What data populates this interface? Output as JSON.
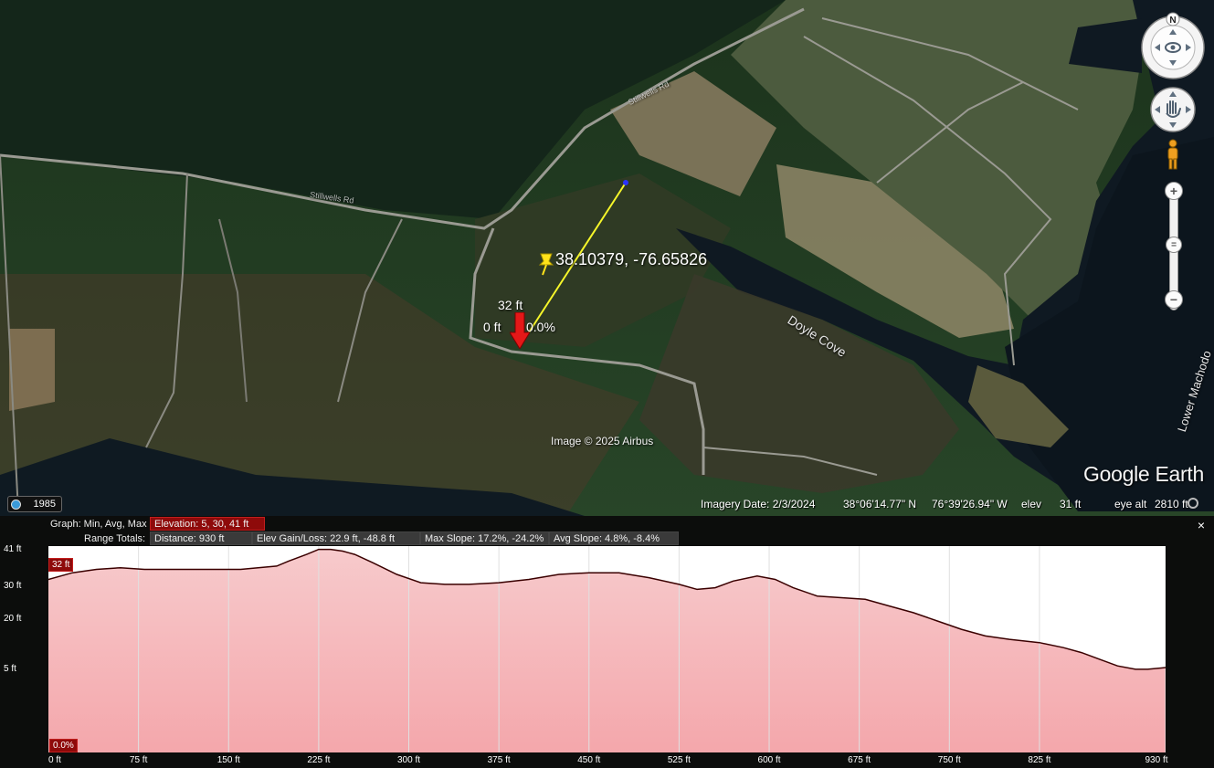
{
  "map": {
    "coordinate_label": "38.10379, -76.65826",
    "elevation_flag": "32 ft",
    "zero_flag": "0 ft",
    "percent_flag": "0.0%",
    "place_labels": {
      "cove": "Doyle Cove",
      "river": "Lower Machodo",
      "road_upper": "Stillwells Rd",
      "road_left": "Stillwells Rd"
    },
    "copyright": "Image © 2025 Airbus",
    "brand": "Google Earth",
    "history_year": "1985",
    "compass_letter": "N"
  },
  "status_bar": {
    "imagery_date": "Imagery Date: 2/3/2024",
    "latitude": "38°06'14.77\" N",
    "longitude": "76°39'26.94\" W",
    "elev_label": "elev",
    "elev_value": "31 ft",
    "eye_alt_label": "eye alt",
    "eye_alt_value": "2810 ft"
  },
  "profile": {
    "close_label": "×",
    "graph_label": "Graph: Min, Avg, Max",
    "elevation_stat": "Elevation: 5, 30, 41 ft",
    "range_label": "Range Totals:",
    "distance_stat": "Distance: 930 ft",
    "gain_stat": "Elev Gain/Loss: 22.9 ft, -48.8 ft",
    "max_slope_stat": "Max Slope: 17.2%, -24.2%",
    "avg_slope_stat": "Avg Slope: 4.8%, -8.4%",
    "cursor_elev_tag": "32 ft",
    "cursor_slope_tag": "0.0%"
  },
  "chart_data": {
    "type": "area",
    "xlabel": "",
    "ylabel": "",
    "x_unit": "ft",
    "y_unit": "ft",
    "xlim": [
      0,
      930
    ],
    "x_ticks": [
      "0 ft",
      "75 ft",
      "150 ft",
      "225 ft",
      "300 ft",
      "375 ft",
      "450 ft",
      "525 ft",
      "600 ft",
      "675 ft",
      "750 ft",
      "825 ft",
      "930 ft"
    ],
    "x_tick_values": [
      0,
      75,
      150,
      225,
      300,
      375,
      450,
      525,
      600,
      675,
      750,
      825,
      930
    ],
    "y_ticks": [
      "41 ft",
      "30 ft",
      "20 ft",
      "5 ft"
    ],
    "y_tick_values": [
      41,
      30,
      20,
      5
    ],
    "ylim": [
      -20,
      42
    ],
    "series": [
      {
        "fill_color": "#f3a2a6",
        "line_color": "#3a0000",
        "x": [
          0,
          20,
          40,
          60,
          80,
          100,
          130,
          160,
          190,
          200,
          215,
          225,
          235,
          245,
          255,
          270,
          290,
          310,
          330,
          350,
          375,
          400,
          425,
          450,
          475,
          500,
          525,
          540,
          555,
          570,
          590,
          605,
          620,
          640,
          660,
          680,
          700,
          720,
          740,
          760,
          780,
          800,
          825,
          845,
          860,
          875,
          890,
          905,
          915,
          930
        ],
        "values": [
          32,
          34,
          35,
          35.5,
          35,
          35,
          35,
          35,
          36,
          37.5,
          39.5,
          41,
          41,
          40.5,
          39.5,
          37,
          33.5,
          31,
          30.5,
          30.5,
          31,
          32,
          33.5,
          34,
          34,
          32.5,
          30.5,
          29,
          29.5,
          31.5,
          33,
          32,
          29.5,
          27,
          26.5,
          26,
          24,
          22,
          19.5,
          17,
          15,
          14,
          13,
          11.5,
          10,
          8,
          6,
          5,
          5,
          5.5
        ]
      }
    ]
  },
  "colors": {
    "accent_red": "#8e0a0a",
    "path_yellow": "#f6f62a",
    "water": "#0f1922"
  }
}
